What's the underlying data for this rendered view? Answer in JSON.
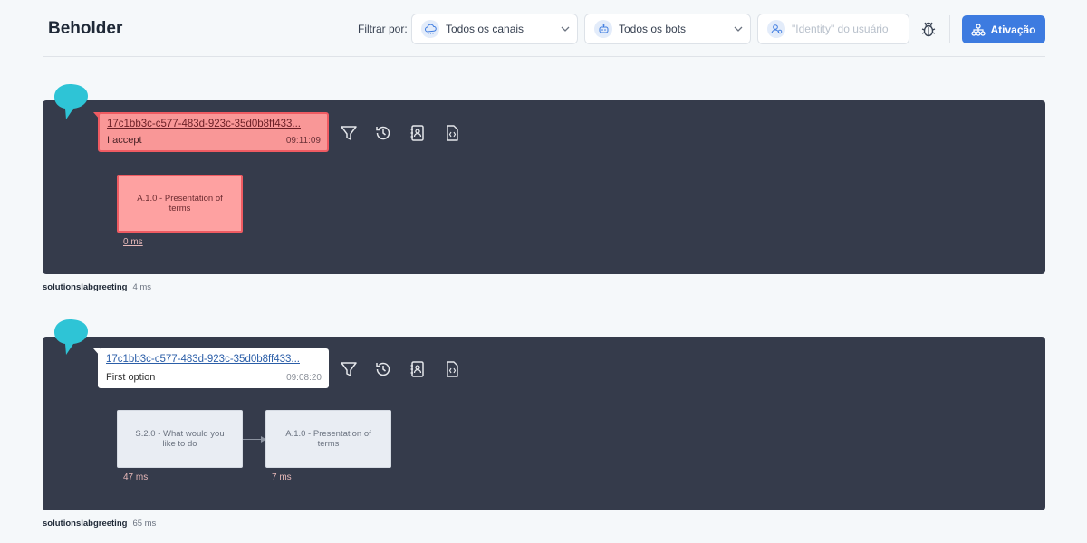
{
  "header": {
    "title": "Beholder",
    "filter_label": "Filtrar por:",
    "channels_select": {
      "value": "Todos os canais",
      "icon": "cloud-icon"
    },
    "bots_select": {
      "value": "Todos os bots",
      "icon": "robot-icon"
    },
    "identity_input": {
      "placeholder": "\"Identity\" do usuário",
      "value": "",
      "icon": "user-icon"
    },
    "debug_icon": "bug-icon",
    "activate_button": {
      "label": "Ativação",
      "icon": "sitemap-icon"
    }
  },
  "colors": {
    "accent": "#3d7be0",
    "panel": "#353b4b",
    "error_fill": "#f99797",
    "error_border": "#ef5b62",
    "bubble": "#2ec4d6"
  },
  "traces": [
    {
      "status": "error",
      "message": {
        "id": "17c1bb3c-c577-483d-923c-35d0b8ff433...",
        "text": "I accept",
        "time": "09:11:09"
      },
      "tools": [
        "filter-icon",
        "history-icon",
        "contact-book-icon",
        "code-file-icon"
      ],
      "states": [
        {
          "label": "A.1.0 - Presentation of terms",
          "duration": "0 ms",
          "status": "error"
        }
      ],
      "bot": "solutionslabgreeting",
      "total": "4 ms"
    },
    {
      "status": "ok",
      "message": {
        "id": "17c1bb3c-c577-483d-923c-35d0b8ff433...",
        "text": "First option",
        "time": "09:08:20"
      },
      "tools": [
        "filter-icon",
        "history-icon",
        "contact-book-icon",
        "code-file-icon"
      ],
      "states": [
        {
          "label": "S.2.0 - What would you like to do",
          "duration": "47 ms",
          "status": "ok"
        },
        {
          "label": "A.1.0 - Presentation of terms",
          "duration": "7 ms",
          "status": "ok"
        }
      ],
      "bot": "solutionslabgreeting",
      "total": "65 ms"
    }
  ]
}
